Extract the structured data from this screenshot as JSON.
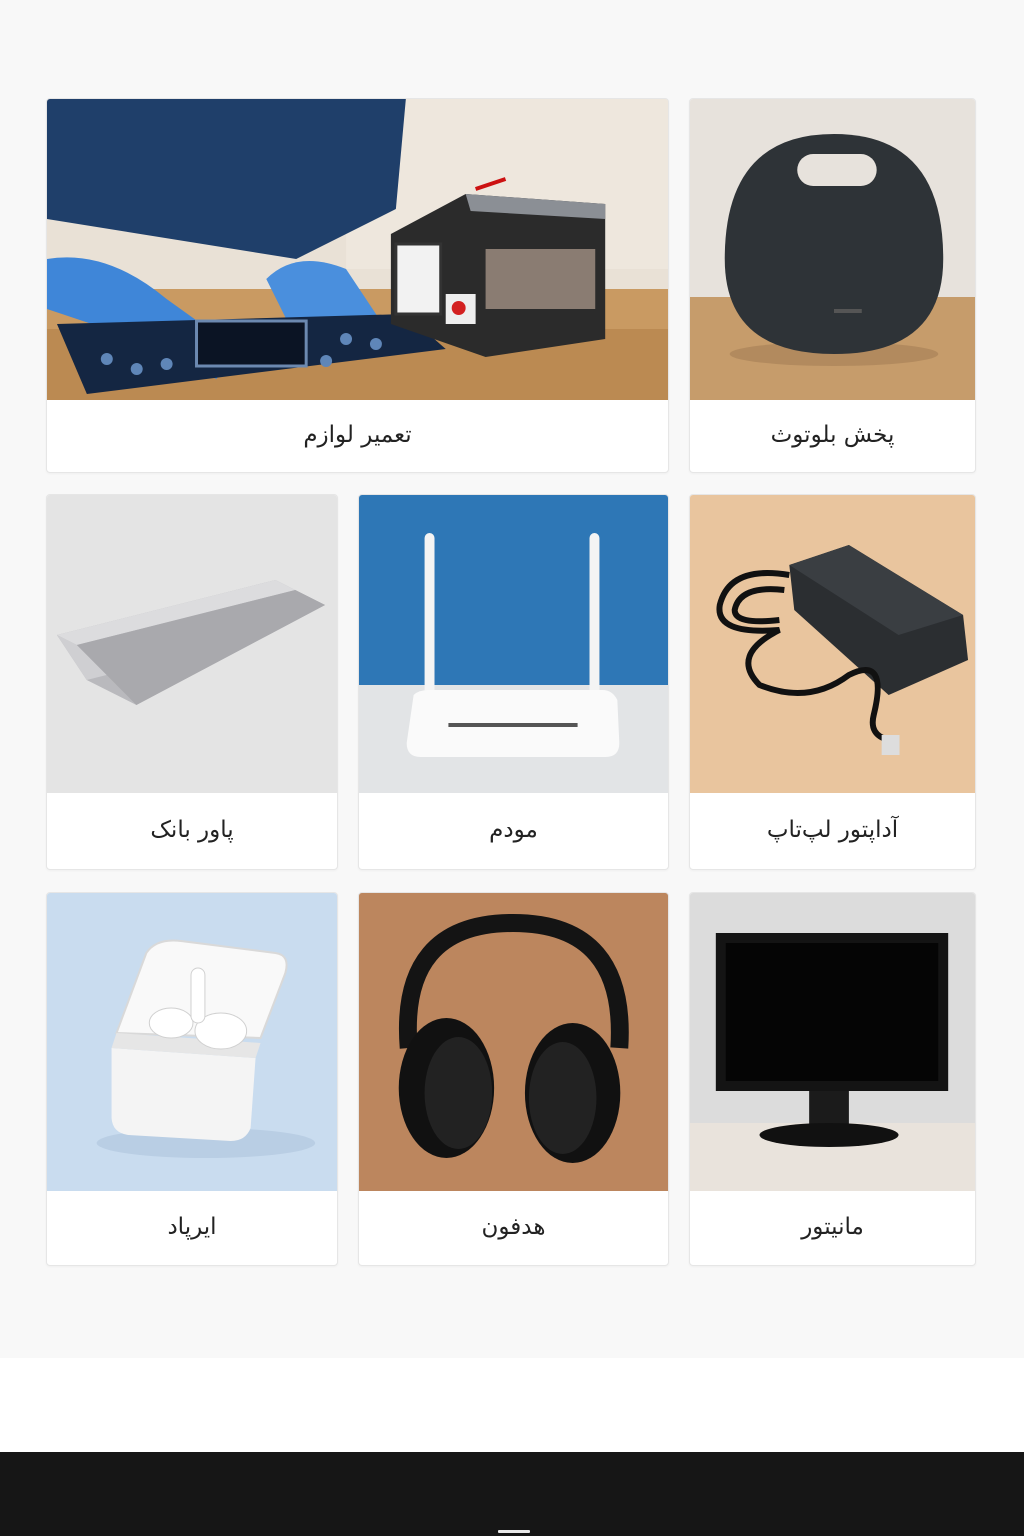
{
  "categories": [
    {
      "label": "تعمیر لوازم",
      "icon": "repair-icon"
    },
    {
      "label": "پخش بلوتوث",
      "icon": "bluetooth-speaker-icon"
    },
    {
      "label": "پاور بانک",
      "icon": "power-bank-icon"
    },
    {
      "label": "مودم",
      "icon": "modem-icon"
    },
    {
      "label": "آداپتور لپ‌تاپ",
      "icon": "laptop-adapter-icon"
    },
    {
      "label": "ایرپاد",
      "icon": "airpods-icon"
    },
    {
      "label": "هدفون",
      "icon": "headphones-icon"
    },
    {
      "label": "مانیتور",
      "icon": "monitor-icon"
    }
  ]
}
